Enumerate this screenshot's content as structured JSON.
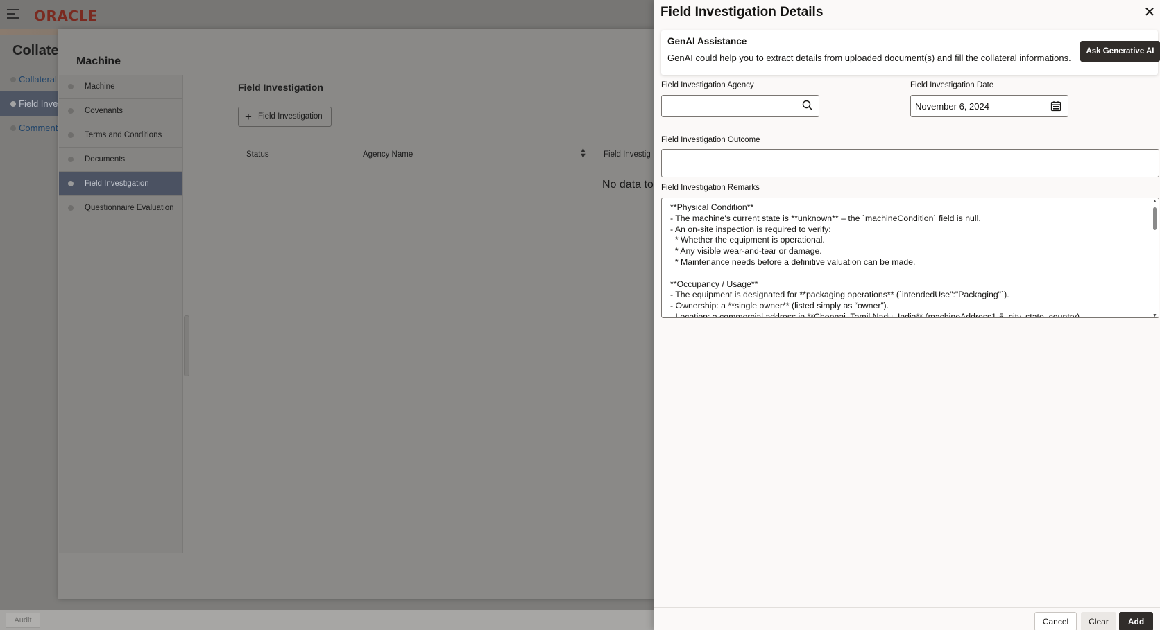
{
  "app": {
    "logo": "ORACLE",
    "page_title": "Collater",
    "nav_items": [
      {
        "label": "Collateral"
      },
      {
        "label": "Field Inves",
        "active": true
      },
      {
        "label": "Comment"
      }
    ],
    "audit_label": "Audit"
  },
  "machine_modal": {
    "title": "Machine",
    "steps": [
      {
        "label": "Machine"
      },
      {
        "label": "Covenants"
      },
      {
        "label": "Terms and Conditions"
      },
      {
        "label": "Documents"
      },
      {
        "label": "Field Investigation",
        "active": true
      },
      {
        "label": "Questionnaire Evaluation"
      }
    ],
    "section_title": "Field Investigation",
    "add_button_label": "Field Investigation",
    "table_columns": [
      "Status",
      "Agency Name",
      "Field Investig"
    ],
    "empty_text": "No data to"
  },
  "drawer": {
    "title": "Field Investigation Details",
    "close_icon": "close-icon",
    "genai": {
      "title": "GenAI Assistance",
      "text": "GenAI could help you to extract details from uploaded document(s) and fill the collateral informations.",
      "button_label": "Ask Generative AI"
    },
    "fields": {
      "agency_label": "Field Investigation Agency",
      "agency_value": "",
      "date_label": "Field Investigation Date",
      "date_value": "November 6, 2024",
      "outcome_label": "Field Investigation Outcome",
      "outcome_value": "",
      "remarks_label": "Field Investigation Remarks",
      "remarks_value": "**Physical Condition**\n- The machine's current state is **unknown** – the `machineCondition` field is null.\n- An on-site inspection is required to verify:\n  * Whether the equipment is operational.\n  * Any visible wear-and-tear or damage.\n  * Maintenance needs before a definitive valuation can be made.\n\n**Occupancy / Usage**\n- The equipment is designated for **packaging operations** (`intendedUse\":\"Packaging\"`).\n- Ownership: a **single owner** (listed simply as “owner”).\n- Location: a commercial address in **Chennai, Tamil Nadu, India** (machineAddress1-5, city, state, country)."
    },
    "buttons": {
      "cancel": "Cancel",
      "clear": "Clear",
      "add": "Add"
    }
  }
}
